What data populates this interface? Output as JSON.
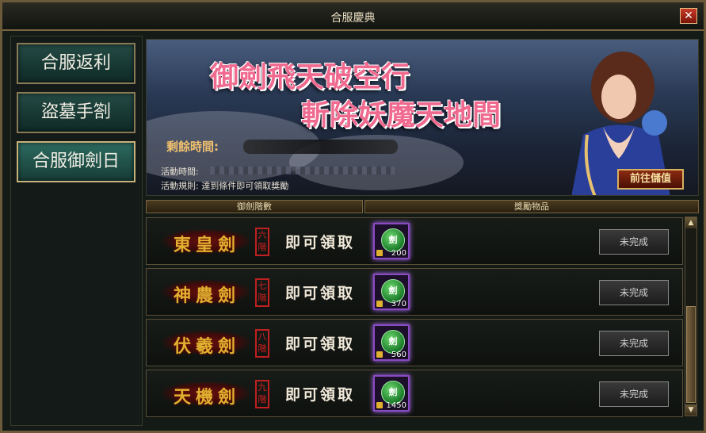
{
  "window": {
    "title": "合服慶典",
    "close": "✕"
  },
  "sidebar": {
    "items": [
      {
        "label": "合服返利"
      },
      {
        "label": "盜墓手劄"
      },
      {
        "label": "合服御劍日"
      }
    ],
    "active": 2
  },
  "banner": {
    "slogan_line1": "御劍飛天破空行",
    "slogan_line2": "斬除妖魔天地間",
    "remaining_label": "剩餘時間:",
    "activity_time_label": "活動時間:",
    "activity_rule": "活動規則: 達到條件即可領取獎勵",
    "recharge_button": "前往儲值"
  },
  "table": {
    "col_sword_level": "御劍階數",
    "col_reward": "獎勵物品",
    "rows": [
      {
        "sword": "東皇劍",
        "level": "六階",
        "claim": "即可領取",
        "item_glyph": "劍",
        "count": "200",
        "status": "未完成"
      },
      {
        "sword": "神農劍",
        "level": "七階",
        "claim": "即可領取",
        "item_glyph": "劍",
        "count": "370",
        "status": "未完成"
      },
      {
        "sword": "伏羲劍",
        "level": "八階",
        "claim": "即可領取",
        "item_glyph": "劍",
        "count": "560",
        "status": "未完成"
      },
      {
        "sword": "天機劍",
        "level": "九階",
        "claim": "即可領取",
        "item_glyph": "劍",
        "count": "1450",
        "status": "未完成"
      }
    ]
  },
  "scrollbar": {
    "up": "▲",
    "down": "▼"
  },
  "colors": {
    "accent_gold": "#e0b030",
    "frame": "#7a6642",
    "claim_text": "#f0e8d8"
  }
}
